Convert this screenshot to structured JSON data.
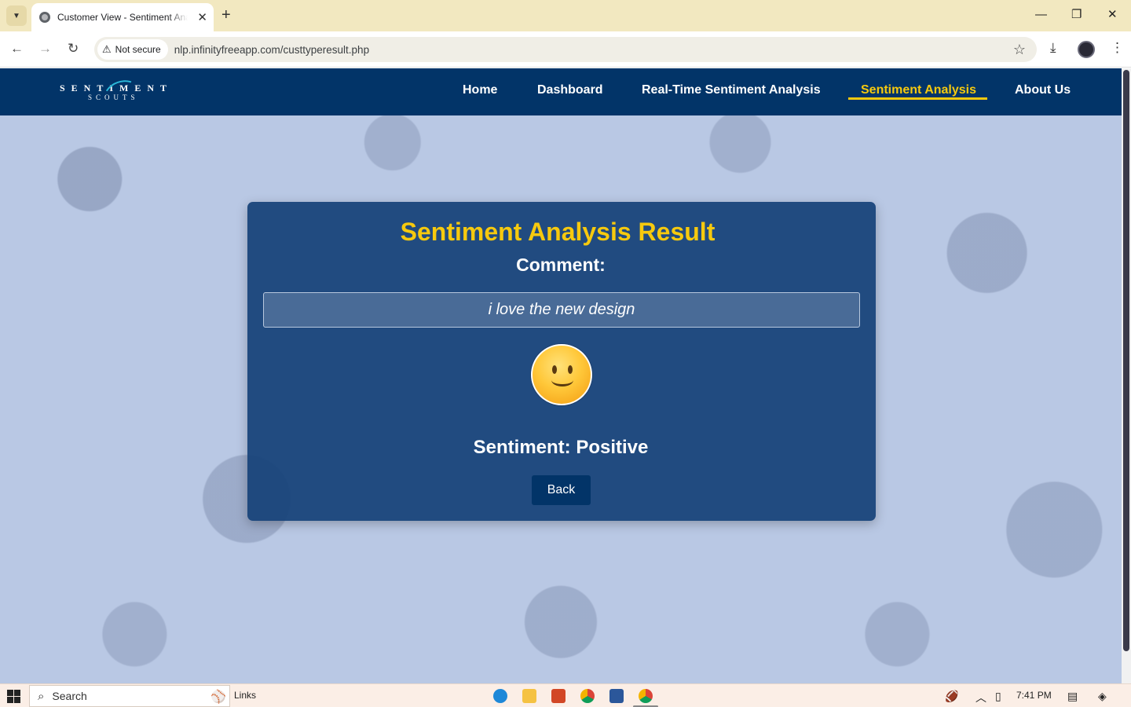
{
  "browser": {
    "tab_title": "Customer View - Sentiment Analysis",
    "security_label": "Not secure",
    "url": "nlp.infinityfreeapp.com/custtyperesult.php"
  },
  "site": {
    "logo_top": "SENTIMENT",
    "logo_bottom": "SCOUTS",
    "nav": [
      {
        "label": "Home"
      },
      {
        "label": "Dashboard"
      },
      {
        "label": "Real-Time Sentiment Analysis"
      },
      {
        "label": "Sentiment Analysis",
        "active": true
      },
      {
        "label": "About Us"
      }
    ]
  },
  "result": {
    "title": "Sentiment Analysis Result",
    "comment_label": "Comment:",
    "comment_text": "i love the new design",
    "emoji": "slightly-smiling-face",
    "sentiment_text": "Sentiment: Positive",
    "back_label": "Back"
  },
  "taskbar": {
    "search_label": "Search",
    "links_label": "Links",
    "time": "7:41 PM"
  },
  "colors": {
    "nav_bg": "#023468",
    "accent_yellow": "#f6c90e",
    "card_bg": "#164278",
    "page_bg": "#b9c8e4"
  }
}
